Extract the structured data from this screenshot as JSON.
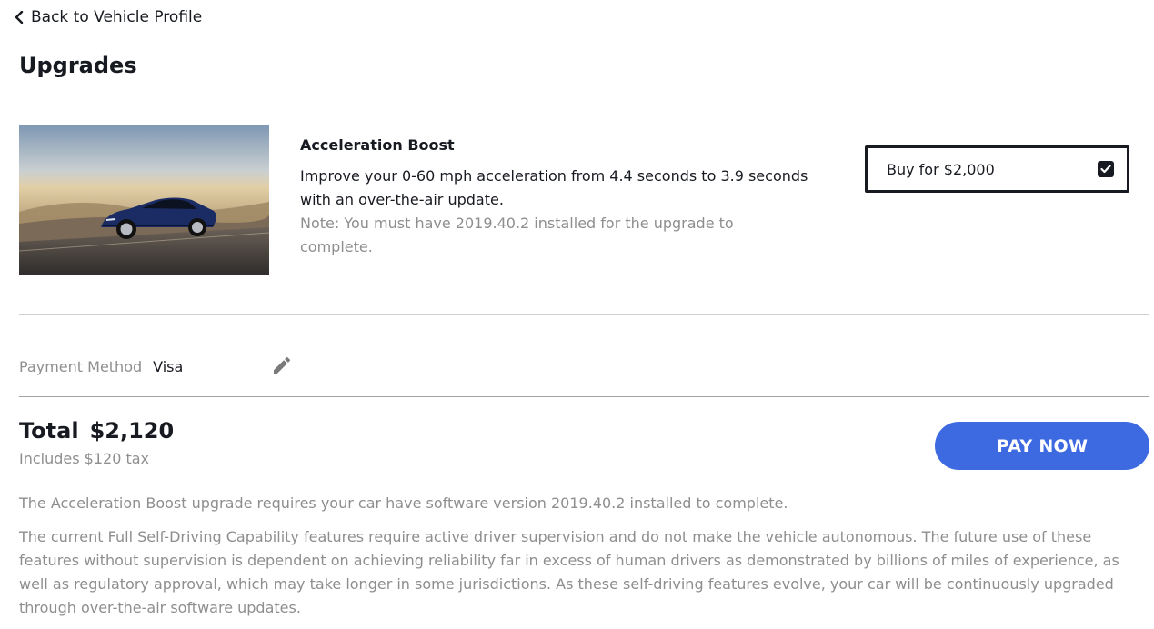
{
  "nav": {
    "back_label": "Back to Vehicle Profile"
  },
  "page": {
    "title": "Upgrades"
  },
  "upgrade": {
    "name": "Acceleration Boost",
    "description": "Improve your 0-60 mph acceleration from 4.4 seconds to 3.9 seconds with an over-the-air update.",
    "note": "Note: You must have 2019.40.2 installed for the upgrade to complete.",
    "buy_label": "Buy for $2,000",
    "selected": true,
    "image_icon": "car-image"
  },
  "payment": {
    "label": "Payment Method",
    "value": "Visa",
    "edit_icon": "pencil-icon"
  },
  "total": {
    "label": "Total",
    "amount": "$2,120",
    "tax_note": "Includes $120 tax"
  },
  "pay_button": {
    "label": "PAY NOW",
    "color": "#3e6ae1"
  },
  "disclaimers": {
    "software": "The Acceleration Boost upgrade requires your car have software version 2019.40.2 installed to complete.",
    "fsd": "The current Full Self-Driving Capability features require active driver supervision and do not make the vehicle autonomous. The future use of these features without supervision is dependent on achieving reliability far in excess of human drivers as demonstrated by billions of miles of experience, as well as regulatory approval, which may take longer in some jurisdictions. As these self-driving features evolve, your car will be continuously upgraded through over-the-air software updates."
  }
}
